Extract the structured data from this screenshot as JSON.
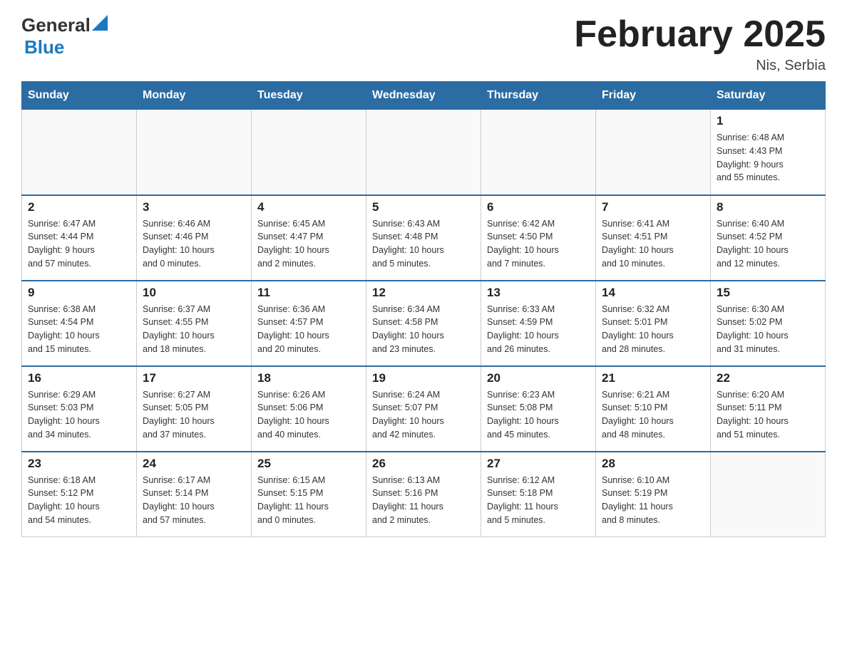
{
  "logo": {
    "general": "General",
    "blue": "Blue",
    "tagline": ""
  },
  "header": {
    "title": "February 2025",
    "location": "Nis, Serbia"
  },
  "weekdays": [
    "Sunday",
    "Monday",
    "Tuesday",
    "Wednesday",
    "Thursday",
    "Friday",
    "Saturday"
  ],
  "weeks": [
    [
      {
        "day": "",
        "info": ""
      },
      {
        "day": "",
        "info": ""
      },
      {
        "day": "",
        "info": ""
      },
      {
        "day": "",
        "info": ""
      },
      {
        "day": "",
        "info": ""
      },
      {
        "day": "",
        "info": ""
      },
      {
        "day": "1",
        "info": "Sunrise: 6:48 AM\nSunset: 4:43 PM\nDaylight: 9 hours\nand 55 minutes."
      }
    ],
    [
      {
        "day": "2",
        "info": "Sunrise: 6:47 AM\nSunset: 4:44 PM\nDaylight: 9 hours\nand 57 minutes."
      },
      {
        "day": "3",
        "info": "Sunrise: 6:46 AM\nSunset: 4:46 PM\nDaylight: 10 hours\nand 0 minutes."
      },
      {
        "day": "4",
        "info": "Sunrise: 6:45 AM\nSunset: 4:47 PM\nDaylight: 10 hours\nand 2 minutes."
      },
      {
        "day": "5",
        "info": "Sunrise: 6:43 AM\nSunset: 4:48 PM\nDaylight: 10 hours\nand 5 minutes."
      },
      {
        "day": "6",
        "info": "Sunrise: 6:42 AM\nSunset: 4:50 PM\nDaylight: 10 hours\nand 7 minutes."
      },
      {
        "day": "7",
        "info": "Sunrise: 6:41 AM\nSunset: 4:51 PM\nDaylight: 10 hours\nand 10 minutes."
      },
      {
        "day": "8",
        "info": "Sunrise: 6:40 AM\nSunset: 4:52 PM\nDaylight: 10 hours\nand 12 minutes."
      }
    ],
    [
      {
        "day": "9",
        "info": "Sunrise: 6:38 AM\nSunset: 4:54 PM\nDaylight: 10 hours\nand 15 minutes."
      },
      {
        "day": "10",
        "info": "Sunrise: 6:37 AM\nSunset: 4:55 PM\nDaylight: 10 hours\nand 18 minutes."
      },
      {
        "day": "11",
        "info": "Sunrise: 6:36 AM\nSunset: 4:57 PM\nDaylight: 10 hours\nand 20 minutes."
      },
      {
        "day": "12",
        "info": "Sunrise: 6:34 AM\nSunset: 4:58 PM\nDaylight: 10 hours\nand 23 minutes."
      },
      {
        "day": "13",
        "info": "Sunrise: 6:33 AM\nSunset: 4:59 PM\nDaylight: 10 hours\nand 26 minutes."
      },
      {
        "day": "14",
        "info": "Sunrise: 6:32 AM\nSunset: 5:01 PM\nDaylight: 10 hours\nand 28 minutes."
      },
      {
        "day": "15",
        "info": "Sunrise: 6:30 AM\nSunset: 5:02 PM\nDaylight: 10 hours\nand 31 minutes."
      }
    ],
    [
      {
        "day": "16",
        "info": "Sunrise: 6:29 AM\nSunset: 5:03 PM\nDaylight: 10 hours\nand 34 minutes."
      },
      {
        "day": "17",
        "info": "Sunrise: 6:27 AM\nSunset: 5:05 PM\nDaylight: 10 hours\nand 37 minutes."
      },
      {
        "day": "18",
        "info": "Sunrise: 6:26 AM\nSunset: 5:06 PM\nDaylight: 10 hours\nand 40 minutes."
      },
      {
        "day": "19",
        "info": "Sunrise: 6:24 AM\nSunset: 5:07 PM\nDaylight: 10 hours\nand 42 minutes."
      },
      {
        "day": "20",
        "info": "Sunrise: 6:23 AM\nSunset: 5:08 PM\nDaylight: 10 hours\nand 45 minutes."
      },
      {
        "day": "21",
        "info": "Sunrise: 6:21 AM\nSunset: 5:10 PM\nDaylight: 10 hours\nand 48 minutes."
      },
      {
        "day": "22",
        "info": "Sunrise: 6:20 AM\nSunset: 5:11 PM\nDaylight: 10 hours\nand 51 minutes."
      }
    ],
    [
      {
        "day": "23",
        "info": "Sunrise: 6:18 AM\nSunset: 5:12 PM\nDaylight: 10 hours\nand 54 minutes."
      },
      {
        "day": "24",
        "info": "Sunrise: 6:17 AM\nSunset: 5:14 PM\nDaylight: 10 hours\nand 57 minutes."
      },
      {
        "day": "25",
        "info": "Sunrise: 6:15 AM\nSunset: 5:15 PM\nDaylight: 11 hours\nand 0 minutes."
      },
      {
        "day": "26",
        "info": "Sunrise: 6:13 AM\nSunset: 5:16 PM\nDaylight: 11 hours\nand 2 minutes."
      },
      {
        "day": "27",
        "info": "Sunrise: 6:12 AM\nSunset: 5:18 PM\nDaylight: 11 hours\nand 5 minutes."
      },
      {
        "day": "28",
        "info": "Sunrise: 6:10 AM\nSunset: 5:19 PM\nDaylight: 11 hours\nand 8 minutes."
      },
      {
        "day": "",
        "info": ""
      }
    ]
  ]
}
